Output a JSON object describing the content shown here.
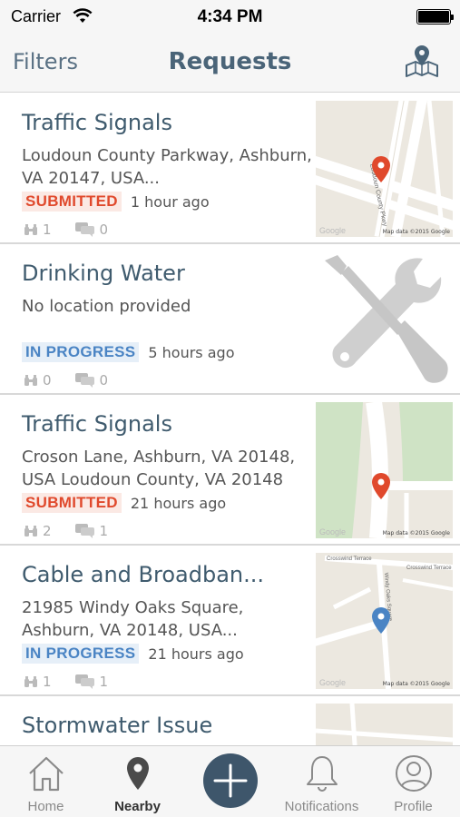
{
  "status_bar": {
    "carrier": "Carrier",
    "time": "4:34 PM"
  },
  "nav": {
    "filters_label": "Filters",
    "title": "Requests",
    "map_icon": "map-pin-icon"
  },
  "colors": {
    "submitted": "#e0492c",
    "in_progress": "#4a84c4",
    "accent": "#3e566b",
    "title": "#3f5b6e"
  },
  "requests": [
    {
      "title": "Traffic Signals",
      "address": "Loudoun County Parkway, Ashburn, VA 20147, USA...",
      "status": "SUBMITTED",
      "time": "1 hour ago",
      "watchers": "1",
      "comments": "0",
      "thumbnail": "map",
      "map_credit": "Map data ©2015 Google",
      "map_brand": "Google",
      "pin_color": "#e0492c"
    },
    {
      "title": "Drinking Water",
      "address": "No location provided",
      "status": "IN PROGRESS",
      "time": "5 hours ago",
      "watchers": "0",
      "comments": "0",
      "thumbnail": "tools-icon"
    },
    {
      "title": "Traffic Signals",
      "address": "Croson Lane, Ashburn, VA 20148, USA Loudoun County, VA 20148",
      "status": "SUBMITTED",
      "time": "21 hours ago",
      "watchers": "2",
      "comments": "1",
      "thumbnail": "map",
      "map_credit": "Map data ©2015 Google",
      "map_brand": "Google",
      "pin_color": "#e0492c"
    },
    {
      "title": "Cable and Broadban...",
      "address": "21985 Windy Oaks Square, Ashburn, VA 20148, USA...",
      "status": "IN PROGRESS",
      "time": "21 hours ago",
      "watchers": "1",
      "comments": "1",
      "thumbnail": "map",
      "map_credit": "Map data ©2015 Google",
      "map_brand": "Google",
      "pin_color": "#4a84c4",
      "street_labels": [
        "Crosswind Terrace",
        "Crosswind Terrace",
        "Windy Oaks Square"
      ]
    },
    {
      "title": "Stormwater Issue",
      "thumbnail": "map"
    }
  ],
  "map1_street_label": "Loudoun County Pkwy",
  "tabs": [
    {
      "label": "Home",
      "icon": "home-icon"
    },
    {
      "label": "Nearby",
      "icon": "location-pin-icon",
      "active": true
    },
    {
      "label": "",
      "icon": "plus-icon"
    },
    {
      "label": "Notifications",
      "icon": "bell-icon"
    },
    {
      "label": "Profile",
      "icon": "user-icon"
    }
  ]
}
